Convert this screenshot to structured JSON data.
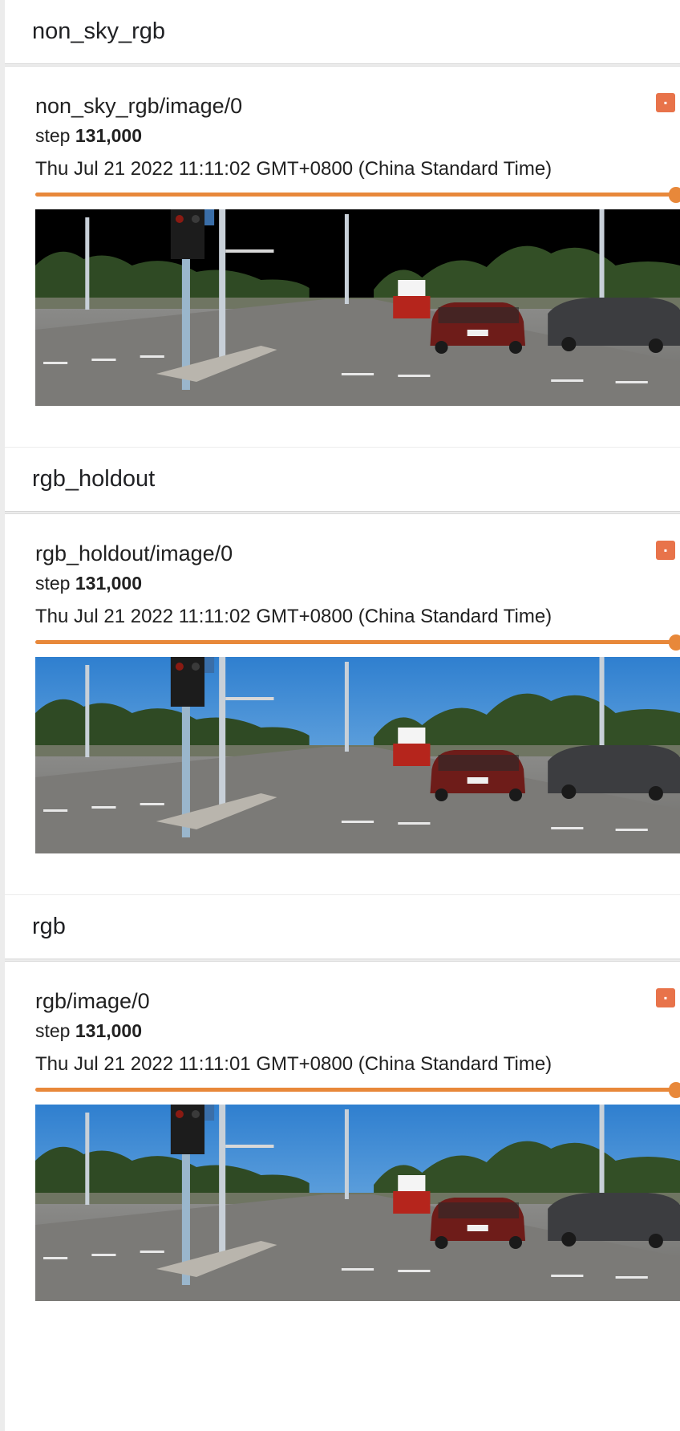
{
  "sections": [
    {
      "header": "non_sky_rgb",
      "card": {
        "title": "non_sky_rgb/image/0",
        "step_label": "step",
        "step_value": "131,000",
        "timestamp": "Thu Jul 21 2022 11:11:02 GMT+0800 (China Standard Time)",
        "sky": "masked"
      }
    },
    {
      "header": "rgb_holdout",
      "card": {
        "title": "rgb_holdout/image/0",
        "step_label": "step",
        "step_value": "131,000",
        "timestamp": "Thu Jul 21 2022 11:11:02 GMT+0800 (China Standard Time)",
        "sky": "blue"
      }
    },
    {
      "header": "rgb",
      "card": {
        "title": "rgb/image/0",
        "step_label": "step",
        "step_value": "131,000",
        "timestamp": "Thu Jul 21 2022 11:11:01 GMT+0800 (China Standard Time)",
        "sky": "blue"
      }
    }
  ],
  "slider": {
    "position": 1.0
  },
  "colors": {
    "accent": "#e8883a",
    "expand_button": "#e8734a",
    "header_bg": "#ffffff",
    "page_bg": "#ececec",
    "masked_sky": "#000000",
    "blue_sky": "#3f8fd8"
  },
  "icons": {
    "expand": "expand-icon"
  }
}
